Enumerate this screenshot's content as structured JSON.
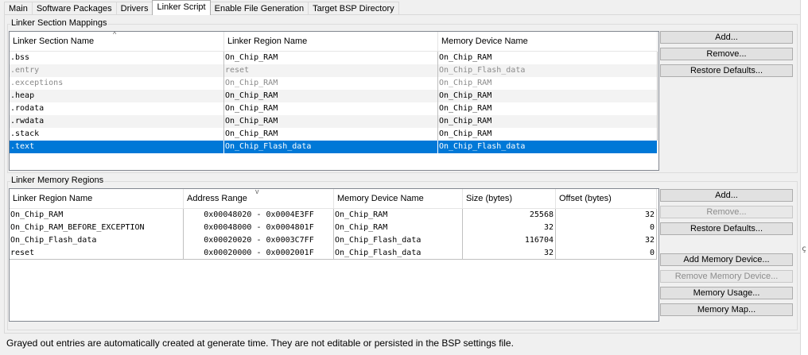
{
  "tabs": [
    "Main",
    "Software Packages",
    "Drivers",
    "Linker Script",
    "Enable File Generation",
    "Target BSP Directory"
  ],
  "active_tab": "Linker Script",
  "section_group": {
    "title": "Linker Section Mappings",
    "columns": [
      "Linker Section Name",
      "Linker Region Name",
      "Memory Device Name"
    ],
    "sort_indicator": "^",
    "rows": [
      {
        "section": ".bss",
        "region": "On_Chip_RAM",
        "device": "On_Chip_RAM",
        "state": "normal"
      },
      {
        "section": ".entry",
        "region": "reset",
        "device": "On_Chip_Flash_data",
        "state": "gray"
      },
      {
        "section": ".exceptions",
        "region": "On_Chip_RAM",
        "device": "On_Chip_RAM",
        "state": "gray"
      },
      {
        "section": ".heap",
        "region": "On_Chip_RAM",
        "device": "On_Chip_RAM",
        "state": "normal"
      },
      {
        "section": ".rodata",
        "region": "On_Chip_RAM",
        "device": "On_Chip_RAM",
        "state": "normal"
      },
      {
        "section": ".rwdata",
        "region": "On_Chip_RAM",
        "device": "On_Chip_RAM",
        "state": "normal"
      },
      {
        "section": ".stack",
        "region": "On_Chip_RAM",
        "device": "On_Chip_RAM",
        "state": "normal"
      },
      {
        "section": ".text",
        "region": "On_Chip_Flash_data",
        "device": "On_Chip_Flash_data",
        "state": "selected"
      }
    ],
    "buttons": [
      {
        "label": "Add...",
        "enabled": true
      },
      {
        "label": "Remove...",
        "enabled": true
      },
      {
        "label": "Restore Defaults...",
        "enabled": true
      }
    ]
  },
  "memory_group": {
    "title": "Linker Memory Regions",
    "columns": [
      "Linker Region Name",
      "Address Range",
      "Memory Device Name",
      "Size (bytes)",
      "Offset (bytes)"
    ],
    "sort_indicator": "v",
    "rows": [
      {
        "region": "On_Chip_RAM",
        "range": "0x00048020 - 0x0004E3FF",
        "device": "On_Chip_RAM",
        "size": "25568",
        "offset": "32"
      },
      {
        "region": "On_Chip_RAM_BEFORE_EXCEPTION",
        "range": "0x00048000 - 0x0004801F",
        "device": "On_Chip_RAM",
        "size": "32",
        "offset": "0"
      },
      {
        "region": "On_Chip_Flash_data",
        "range": "0x00020020 - 0x0003C7FF",
        "device": "On_Chip_Flash_data",
        "size": "116704",
        "offset": "32"
      },
      {
        "region": "reset",
        "range": "0x00020000 - 0x0002001F",
        "device": "On_Chip_Flash_data",
        "size": "32",
        "offset": "0"
      }
    ],
    "buttons": [
      {
        "label": "Add...",
        "enabled": true
      },
      {
        "label": "Remove...",
        "enabled": false
      },
      {
        "label": "Restore Defaults...",
        "enabled": true
      },
      {
        "label": "Add Memory Device...",
        "enabled": true
      },
      {
        "label": "Remove Memory Device...",
        "enabled": false
      },
      {
        "label": "Memory Usage...",
        "enabled": true
      },
      {
        "label": "Memory Map...",
        "enabled": true
      }
    ]
  },
  "footer_text": "Grayed out entries are automatically created at generate time. They are not editable or persisted in the BSP settings file.",
  "edge_mark": "ç",
  "colors": {
    "selection": "#0078d7",
    "grayed_text": "#8a8a8a"
  }
}
